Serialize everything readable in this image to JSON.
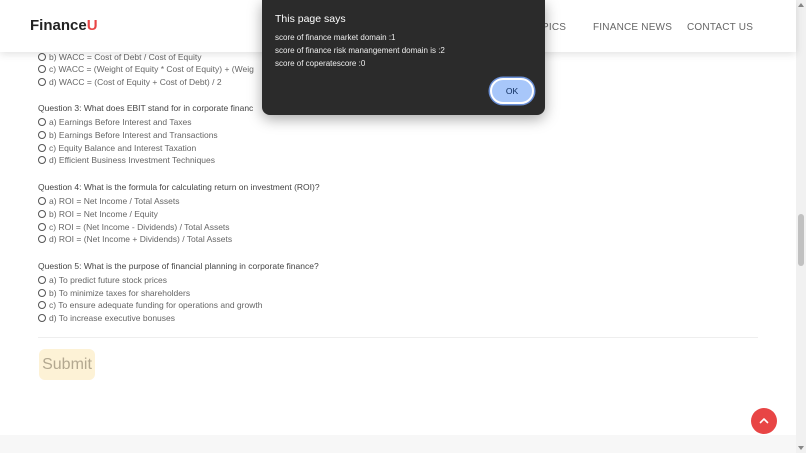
{
  "navbar": {
    "brand_main": "Finance",
    "brand_accent": "U",
    "links": [
      "PICS",
      "FINANCE NEWS",
      "CONTACT US"
    ]
  },
  "quiz": {
    "q2_partial_options": [
      "b) WACC = Cost of Debt / Cost of Equity",
      "c) WACC = (Weight of Equity * Cost of Equity) + (Weig",
      "d) WACC = (Cost of Equity + Cost of Debt) / 2"
    ],
    "questions": [
      {
        "text": "Question 3: What does EBIT stand for in corporate financ",
        "options": [
          "a) Earnings Before Interest and Taxes",
          "b) Earnings Before Interest and Transactions",
          "c) Equity Balance and Interest Taxation",
          "d) Efficient Business Investment Techniques"
        ]
      },
      {
        "text": "Question 4: What is the formula for calculating return on investment (ROI)?",
        "options": [
          "a) ROI = Net Income / Total Assets",
          "b) ROI = Net Income / Equity",
          "c) ROI = (Net Income - Dividends) / Total Assets",
          "d) ROI = (Net Income + Dividends) / Total Assets"
        ]
      },
      {
        "text": "Question 5: What is the purpose of financial planning in corporate finance?",
        "options": [
          "a) To predict future stock prices",
          "b) To minimize taxes for shareholders",
          "c) To ensure adequate funding for operations and growth",
          "d) To increase executive bonuses"
        ]
      }
    ],
    "submit_label": "Submit"
  },
  "dialog": {
    "title": "This page says",
    "lines": [
      "score of finance market domain :1",
      "score of finance risk manangement domain is :2",
      "score of coperatescore :0"
    ],
    "ok_label": "OK"
  },
  "icons": {
    "back_to_top": "chevron-up-icon",
    "accent_color": "#e84545"
  }
}
